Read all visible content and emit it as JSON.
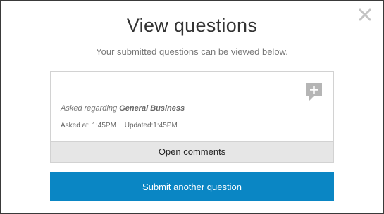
{
  "modal": {
    "title": "View questions",
    "subtitle": "Your submitted questions can be viewed below.",
    "close_icon": "close-icon"
  },
  "question_card": {
    "asked_regarding_prefix": "Asked regarding",
    "topic": "General Business",
    "asked_at": "Asked at: 1:45PM",
    "updated": "Updated:1:45PM",
    "add_comment_icon": "add-comment-icon",
    "open_comments_label": "Open comments"
  },
  "actions": {
    "submit_another_label": "Submit another question"
  },
  "colors": {
    "accent": "#0a86c4",
    "comment_bar": "#e6e6e6"
  }
}
